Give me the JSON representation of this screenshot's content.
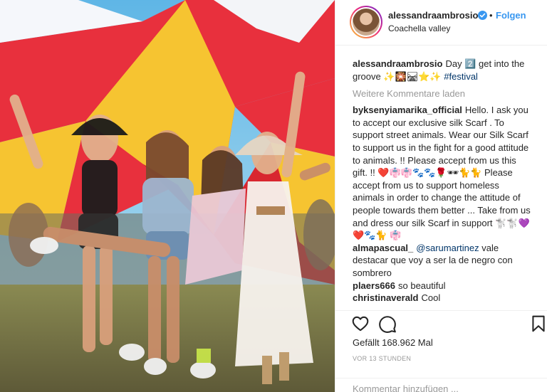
{
  "post": {
    "username": "alessandraambrosio",
    "follow_label": "Folgen",
    "separator": "•",
    "location": "Coachella valley"
  },
  "caption": {
    "username": "alessandraambrosio",
    "text": "Day 2️⃣ get into the groove ✨🎇🛤⭐✨",
    "hashtag": "#festival"
  },
  "load_more_label": "Weitere Kommentare laden",
  "comments": [
    {
      "username": "byksenyiamarika_official",
      "text": "Hello. I ask you to accept our exclusive silk Scarf . To support street animals. Wear our Silk Scarf to support us in the fight for a good attitude to animals. !! Please accept from us this gift. !! ❤️👘👘🐾🐾🌹🕶🐈🐈 Please accept from us to support homeless animals in order to change the attitude of people towards them better ... Take from us and dress our silk Scarf in support 🐩🐩💜❤️🐾🐈 👘"
    },
    {
      "username": "almapascual_",
      "mention": "@sarumartinez",
      "text": "vale destacar que voy a ser la de negro con sombrero"
    },
    {
      "username": "plaers666",
      "text": "so beautiful"
    },
    {
      "username": "christinaverald",
      "text": "Cool"
    }
  ],
  "actions": {
    "like_icon": "heart-outline-icon",
    "comment_icon": "speech-bubble-icon",
    "save_icon": "bookmark-icon"
  },
  "likes_text": "Gefällt 168.962 Mal",
  "time_text": "VOR 13 STUNDEN",
  "comment_input_placeholder": "Kommentar hinzufügen ...",
  "colors": {
    "follow_blue": "#3897f0",
    "hashtag": "#003569",
    "muted": "#999999",
    "text": "#262626",
    "verified": "#3897f0"
  }
}
